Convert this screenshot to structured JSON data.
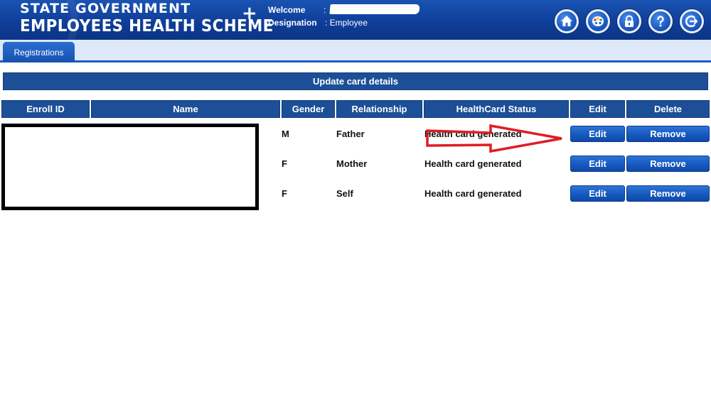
{
  "header": {
    "title_line1": "STATE GOVERNMENT",
    "title_line2": "EMPLOYEES HEALTH SCHEME",
    "plus_symbol": "+",
    "welcome_label": "Welcome",
    "welcome_colon": ":",
    "designation_label": "Designation",
    "designation_value": ": Employee",
    "icons": [
      "home-icon",
      "palette-icon",
      "lock-icon",
      "help-icon",
      "logout-icon"
    ]
  },
  "tabs": [
    {
      "label": "Registrations",
      "active": true
    }
  ],
  "section": {
    "title": "Update card details"
  },
  "table": {
    "columns": [
      "Enroll ID",
      "Name",
      "Gender",
      "Relationship",
      "HealthCard Status",
      "Edit",
      "Delete"
    ],
    "rows": [
      {
        "gender": "M",
        "relationship": "Father",
        "status": "Health card generated",
        "edit_label": "Edit",
        "remove_label": "Remove"
      },
      {
        "gender": "F",
        "relationship": "Mother",
        "status": "Health card generated",
        "edit_label": "Edit",
        "remove_label": "Remove"
      },
      {
        "gender": "F",
        "relationship": "Self",
        "status": "Health card generated",
        "edit_label": "Edit",
        "remove_label": "Remove"
      }
    ]
  },
  "colors": {
    "header_blue": "#0f3f99",
    "table_header": "#1c4f97",
    "button_blue": "#1457bd",
    "annotation_red": "#e01c24"
  }
}
